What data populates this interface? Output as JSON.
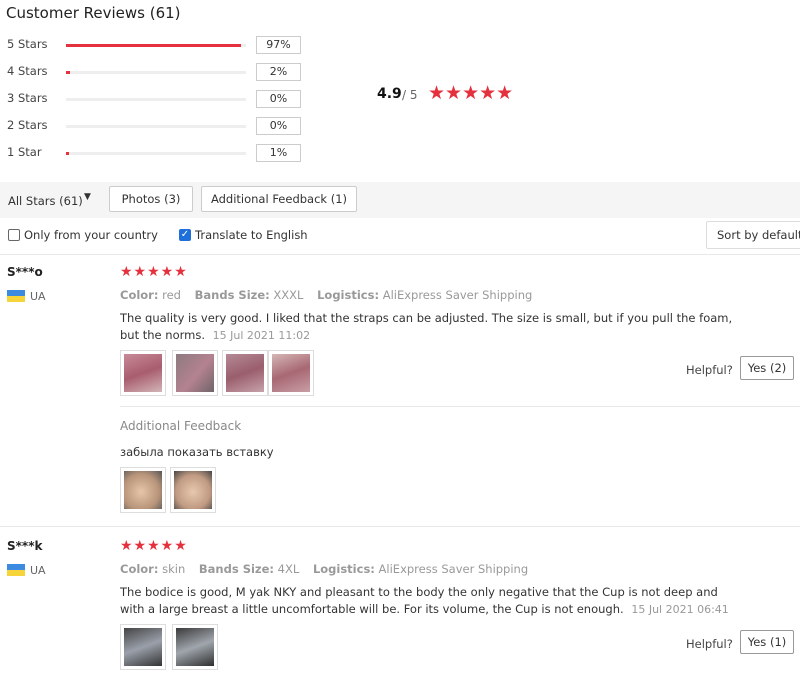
{
  "title": "Customer Reviews (61)",
  "histogram": [
    {
      "label": "5 Stars",
      "percent": "97%",
      "fill": 0.97
    },
    {
      "label": "4 Stars",
      "percent": "2%",
      "fill": 0.02
    },
    {
      "label": "3 Stars",
      "percent": "0%",
      "fill": 0.0
    },
    {
      "label": "2 Stars",
      "percent": "0%",
      "fill": 0.0
    },
    {
      "label": "1 Star",
      "percent": "1%",
      "fill": 0.01
    }
  ],
  "summary": {
    "average": "4.9",
    "out_of": "/ 5",
    "stars": "★★★★★"
  },
  "filters": {
    "all_stars": "All Stars (61)",
    "photos": "Photos (3)",
    "additional_feedback": "Additional Feedback (1)",
    "only_country": "Only from your country",
    "translate": "Translate to English",
    "sort": "Sort by default"
  },
  "accent_color": "#e5313d",
  "reviews": [
    {
      "user": "S***o",
      "country": "UA",
      "stars": "★★★★★",
      "color_label": "Color:",
      "color": "red",
      "size_label": "Bands Size:",
      "size": "XXXL",
      "logistics_label": "Logistics:",
      "logistics": "AliExpress Saver Shipping",
      "text": "The quality is very good. I liked that the straps can be adjusted. The size is small, but if you pull the foam, but the norms.",
      "date": "15 Jul 2021 11:02",
      "helpful": "Helpful?",
      "yes": "Yes (2)",
      "additional_title": "Additional Feedback",
      "additional_text": "забыла показать вставку"
    },
    {
      "user": "S***k",
      "country": "UA",
      "stars": "★★★★★",
      "color_label": "Color:",
      "color": "skin",
      "size_label": "Bands Size:",
      "size": "4XL",
      "logistics_label": "Logistics:",
      "logistics": "AliExpress Saver Shipping",
      "text": "The bodice is good, M yak NKY and pleasant to the body the only negative that the Cup is not deep and with a large breast a little uncomfortable will be. For its volume, the Cup is not enough.",
      "date": "15 Jul 2021 06:41",
      "helpful": "Helpful?",
      "yes": "Yes (1)"
    }
  ]
}
